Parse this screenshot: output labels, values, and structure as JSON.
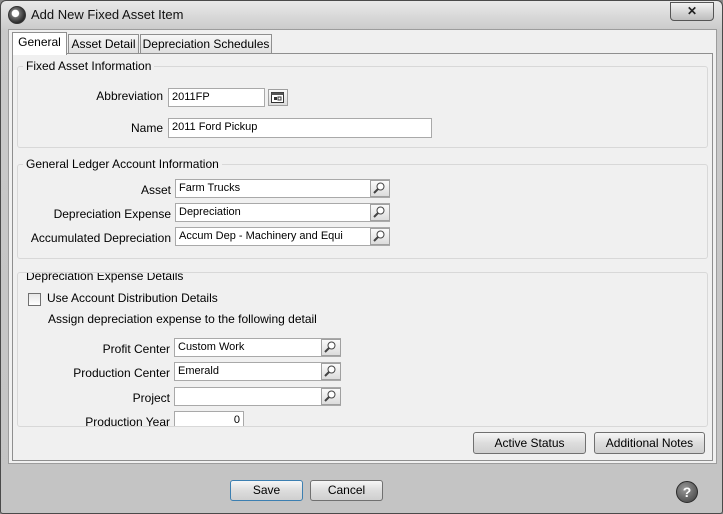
{
  "window": {
    "title": "Add New Fixed Asset Item",
    "close_symbol": "✕"
  },
  "tabs": [
    {
      "label": "General",
      "active": true
    },
    {
      "label": "Asset Detail",
      "active": false
    },
    {
      "label": "Depreciation Schedules",
      "active": false
    }
  ],
  "fixed_asset_info": {
    "title": "Fixed Asset Information",
    "abbreviation_label": "Abbreviation",
    "abbreviation_value": "2011FP",
    "name_label": "Name",
    "name_value": "2011 Ford Pickup"
  },
  "gl_info": {
    "title": "General Ledger Account Information",
    "asset_label": "Asset",
    "asset_value": "Farm Trucks",
    "dep_expense_label": "Depreciation Expense",
    "dep_expense_value": "Depreciation",
    "accum_dep_label": "Accumulated Depreciation",
    "accum_dep_value": "Accum Dep - Machinery and Equi"
  },
  "dep_details": {
    "title": "Depreciation Expense Details",
    "use_distribution_label": "Use Account Distribution Details",
    "use_distribution_checked": false,
    "assign_text": "Assign depreciation expense to the following detail",
    "profit_center_label": "Profit Center",
    "profit_center_value": "Custom Work",
    "production_center_label": "Production Center",
    "production_center_value": "Emerald",
    "project_label": "Project",
    "project_value": "",
    "production_year_label": "Production Year",
    "production_year_value": "0"
  },
  "buttons": {
    "active_status": "Active Status",
    "additional_notes": "Additional Notes",
    "save": "Save",
    "cancel": "Cancel",
    "help": "?"
  },
  "icons": [
    "app-icon",
    "close-icon",
    "calendar-picker-icon",
    "magnifier-icon",
    "help-icon"
  ]
}
